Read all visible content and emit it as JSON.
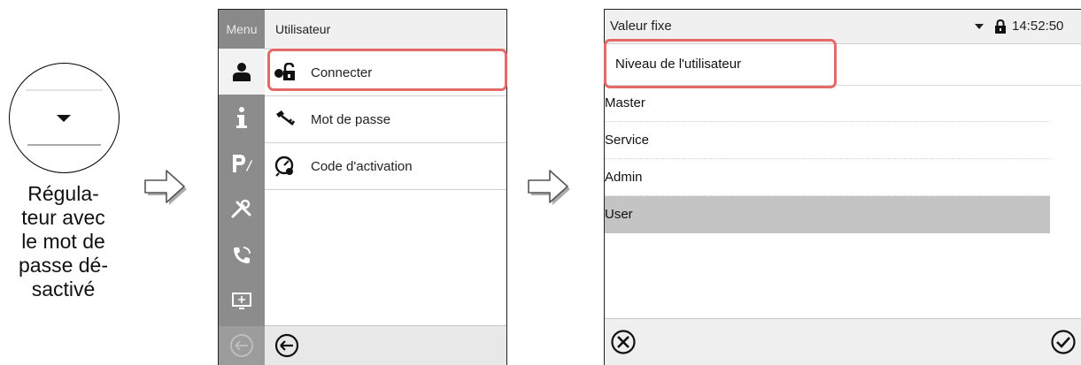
{
  "left": {
    "caption_lines": [
      "Régula-",
      "teur avec",
      "le mot de",
      "passe dé-",
      "sactivé"
    ]
  },
  "menu_panel": {
    "side_label": "Menu",
    "header_title": "Utilisateur",
    "items": [
      {
        "label": "Connecter",
        "icon": "lock-person-icon"
      },
      {
        "label": "Mot de passe",
        "icon": "key-icon"
      },
      {
        "label": "Code d'activation",
        "icon": "activation-code-icon"
      }
    ],
    "side_icons": [
      "user-icon",
      "info-icon",
      "program-edit-icon",
      "tools-icon",
      "service-phone-icon",
      "display-settings-icon",
      "back-icon"
    ]
  },
  "value_panel": {
    "title": "Valeur fixe",
    "time": "14:52:50",
    "subheader": "Niveau de l'utilisateur",
    "options": [
      "Master",
      "Service",
      "Admin",
      "User"
    ],
    "selected_option": "User"
  },
  "colors": {
    "highlight": "#e46a6a",
    "sidebar": "#8c8c8c",
    "selected_row": "#c4c4c4"
  }
}
